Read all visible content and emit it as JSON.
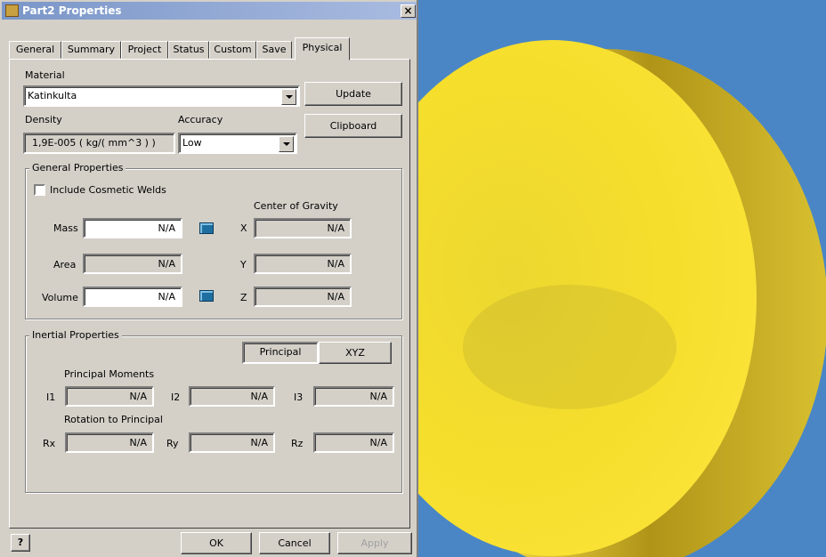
{
  "window": {
    "title": "Part2 Properties",
    "close_symbol": "×"
  },
  "tabs": [
    "General",
    "Summary",
    "Project",
    "Status",
    "Custom",
    "Save",
    "Physical"
  ],
  "active_tab": "Physical",
  "material": {
    "label": "Material",
    "value": "Katinkulta",
    "update_label": "Update",
    "clipboard_label": "Clipboard"
  },
  "density": {
    "label": "Density",
    "value": "1,9E-005 ( kg/( mm^3 ) )"
  },
  "accuracy": {
    "label": "Accuracy",
    "value": "Low"
  },
  "general_properties": {
    "title": "General Properties",
    "cosmetic_welds_label": "Include Cosmetic Welds",
    "cosmetic_welds_checked": false,
    "cog_label": "Center of Gravity",
    "mass_label": "Mass",
    "mass_value": "N/A",
    "area_label": "Area",
    "area_value": "N/A",
    "volume_label": "Volume",
    "volume_value": "N/A",
    "x_label": "X",
    "x_value": "N/A",
    "y_label": "Y",
    "y_value": "N/A",
    "z_label": "Z",
    "z_value": "N/A"
  },
  "inertial_properties": {
    "title": "Inertial Properties",
    "principal_label": "Principal",
    "xyz_label": "XYZ",
    "principal_moments_label": "Principal Moments",
    "i1_label": "I1",
    "i1_value": "N/A",
    "i2_label": "I2",
    "i2_value": "N/A",
    "i3_label": "I3",
    "i3_value": "N/A",
    "rotation_label": "Rotation to Principal",
    "rx_label": "Rx",
    "rx_value": "N/A",
    "ry_label": "Ry",
    "ry_value": "N/A",
    "rz_label": "Rz",
    "rz_value": "N/A"
  },
  "footer": {
    "help_label": "?",
    "ok_label": "OK",
    "cancel_label": "Cancel",
    "apply_label": "Apply"
  },
  "colors": {
    "viewport_bg": "#4a86c6",
    "part_yellow": "#f5dc2a",
    "dialog_bg": "#d4d0c8"
  }
}
